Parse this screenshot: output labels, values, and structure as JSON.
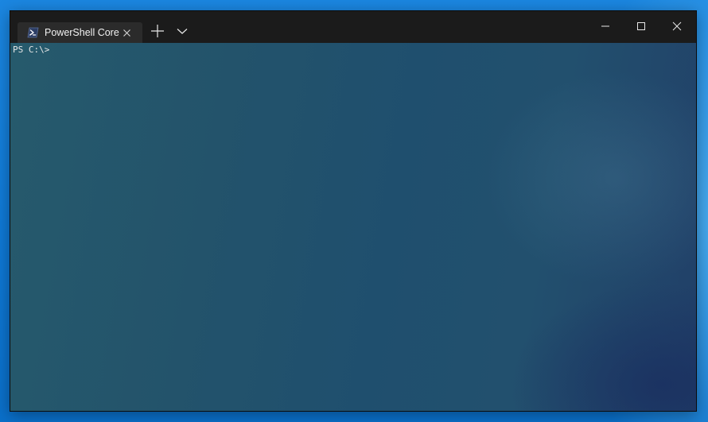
{
  "window": {
    "tabs": [
      {
        "label": "PowerShell Core",
        "icon": "powershell-icon",
        "active": true
      }
    ],
    "controls": {
      "new_tab_icon": "plus-icon",
      "dropdown_icon": "chevron-down-icon",
      "minimize_icon": "minimize-icon",
      "maximize_icon": "maximize-icon",
      "close_icon": "close-icon"
    }
  },
  "terminal": {
    "prompt": "PS C:\\>"
  },
  "colors": {
    "desktop_blue": "#0f79d6",
    "titlebar": "#1b1b1b",
    "active_tab": "#2b2b2b",
    "terminal_background": "#23536b",
    "prompt_text": "#e6e6e6",
    "powershell_icon": "#2c3d64"
  }
}
